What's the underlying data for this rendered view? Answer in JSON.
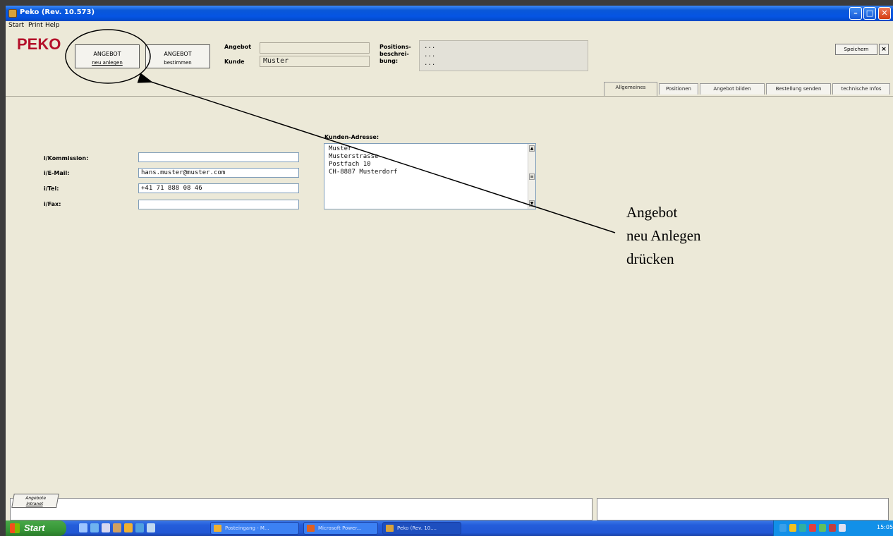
{
  "window": {
    "title": "Peko (Rev. 10.573)",
    "min_icon": "minimize-icon",
    "max_icon": "maximize-icon",
    "close_icon": "close-icon"
  },
  "menu": {
    "start": "Start",
    "print": "Print",
    "help": "Help"
  },
  "header": {
    "logo": "PEKO",
    "btn_neu_line1": "ANGEBOT",
    "btn_neu_line2": "neu anlegen",
    "btn_best_line1": "ANGEBOT",
    "btn_best_line2": "bestimmen",
    "angebot_label": "Angebot",
    "angebot_value": "",
    "kunde_label": "Kunde",
    "kunde_value": "Muster",
    "positions_label_1": "Positions-",
    "positions_label_2": "beschrei-",
    "positions_label_3": "bung:",
    "positions_lines": [
      "...",
      "...",
      "..."
    ],
    "save_label": "Speichern",
    "close_label": "×"
  },
  "tabs": [
    "Allgemeines",
    "Positionen",
    "Angebot bilden",
    "Bestellung senden",
    "technische Infos"
  ],
  "form": {
    "kommission_label": "i/Kommission:",
    "kommission_value": "",
    "email_label": "i/E-Mail:",
    "email_value": "hans.muster@muster.com",
    "tel_label": "i/Tel:",
    "tel_value": "+41 71 888 08 46",
    "fax_label": "i/Fax:",
    "fax_value": "",
    "address_label": "Kunden-Adresse:",
    "address_lines": [
      "Muster",
      "Musterstrasse",
      "Postfach 10",
      "CH-8887 Musterdorf"
    ]
  },
  "annotation": {
    "line1": "Angebot",
    "line2": "neu Anlegen",
    "line3": "drücken"
  },
  "status": {
    "tab_line1": "Angebote",
    "tab_line2": "Intranet"
  },
  "taskbar": {
    "start": "Start",
    "items": [
      "Posteingang - M...",
      "Microsoft Power...",
      "Peko (Rev. 10...."
    ],
    "clock": "15:05"
  },
  "colors": {
    "logo": "#b4102a",
    "window_bg": "#ECE9D8",
    "taskbar": "#245DDB"
  }
}
